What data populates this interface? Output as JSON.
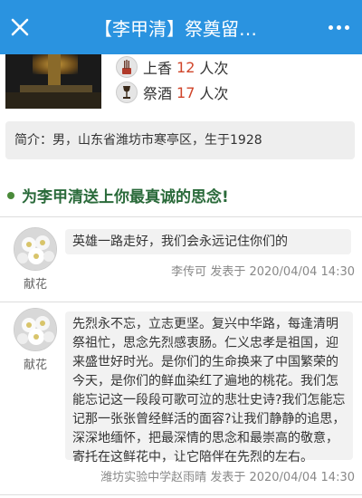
{
  "header": {
    "title": "【李甲清】祭奠留…",
    "close_icon": "close-icon",
    "more_icon": "more-dots-icon",
    "bg_color": "#2a93e0"
  },
  "stats": [
    {
      "label": "上香",
      "count": "12",
      "unit": "人次",
      "icon": "incense-icon"
    },
    {
      "label": "祭酒",
      "count": "17",
      "unit": "人次",
      "icon": "wine-icon"
    }
  ],
  "intro": {
    "text": "简介：男，山东省潍坊市寒亭区，生于1928"
  },
  "section": {
    "title": "为李甲清送上你最真诚的思念!"
  },
  "messages": [
    {
      "text": "英雄一路走好，我们会永远记住你们的",
      "action": "献花",
      "author": "李传可",
      "published_label": "发表于",
      "datetime": "2020/04/04 14:30"
    },
    {
      "text": "先烈永不忘，立志更坚。复兴中华路，每逢清明祭祖忙，思念先烈感衷肠。仁义忠孝是祖国，迎来盛世好时光。是你们的生命换来了中国繁荣的今天，是你们的鲜血染红了遍地的桃花。我们怎能忘记这一段段可歌可泣的悲壮史诗?我们怎能忘记那一张张曾经鲜活的面容?让我们静静的追思，深深地缅怀，把最深情的思念和最崇高的敬意，寄托在这鲜花中，让它陪伴在先烈的左右。",
      "action": "献花",
      "author": "潍坊实验中学赵雨晴",
      "published_label": "发表于",
      "datetime": "2020/04/04 14:30"
    }
  ],
  "colors": {
    "accent": "#2a93e0",
    "count": "#d0452a",
    "section_title": "#2a6a3a"
  }
}
